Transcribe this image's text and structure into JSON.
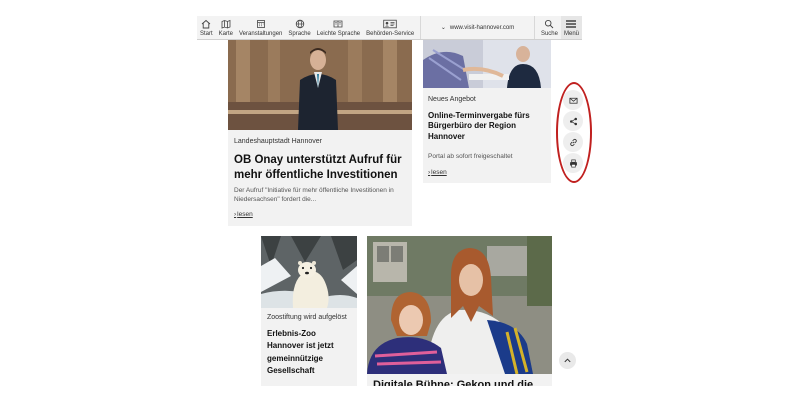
{
  "nav": {
    "items": [
      {
        "label": "Start"
      },
      {
        "label": "Karte"
      },
      {
        "label": "Veranstaltungen"
      },
      {
        "label": "Sprache"
      },
      {
        "label": "Leichte Sprache"
      },
      {
        "label": "Behörden-Service"
      }
    ],
    "url": "www.visit-hannover.com",
    "search_label": "Suche",
    "menu_label": "Menü"
  },
  "articles": [
    {
      "kicker": "Landeshauptstadt Hannover",
      "title": "OB Onay unterstützt Aufruf für mehr öffentliche Investitionen",
      "teaser": "Der Aufruf \"Initiative für mehr öffentliche Investitionen in Niedersachsen\" fordert die...",
      "more": "lesen"
    },
    {
      "kicker": "Neues Angebot",
      "title": "Online-Terminvergabe fürs Bürgerbüro der Region Hannover",
      "teaser": "Portal ab sofort freigeschaltet",
      "more": "lesen"
    },
    {
      "kicker": "Zoostiftung wird aufgelöst",
      "title": "Erlebnis-Zoo Hannover ist jetzt gemeinnützige Gesellschaft"
    },
    {
      "title": "Digitale Bühne: Gekon und die..."
    }
  ],
  "share": {
    "icons": [
      "mail-icon",
      "share-icon",
      "link-icon",
      "print-icon"
    ],
    "highlight_color": "#c0201f"
  }
}
